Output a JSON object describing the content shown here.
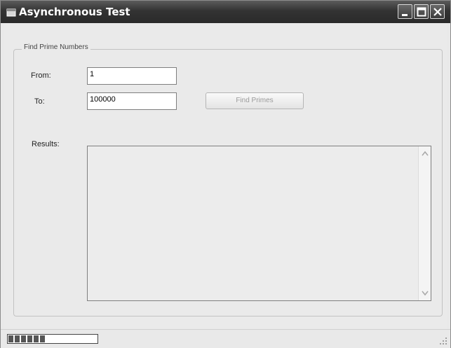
{
  "window": {
    "title": "Asynchronous Test",
    "controls": {
      "minimize": "minimize-icon",
      "maximize": "maximize-icon",
      "close": "close-icon"
    }
  },
  "group": {
    "legend": "Find Prime Numbers"
  },
  "form": {
    "from_label": "From:",
    "from_value": "1",
    "to_label": "To:",
    "to_value": "100000",
    "find_button": "Find Primes",
    "results_label": "Results:"
  },
  "status": {
    "progress": 0.42
  }
}
